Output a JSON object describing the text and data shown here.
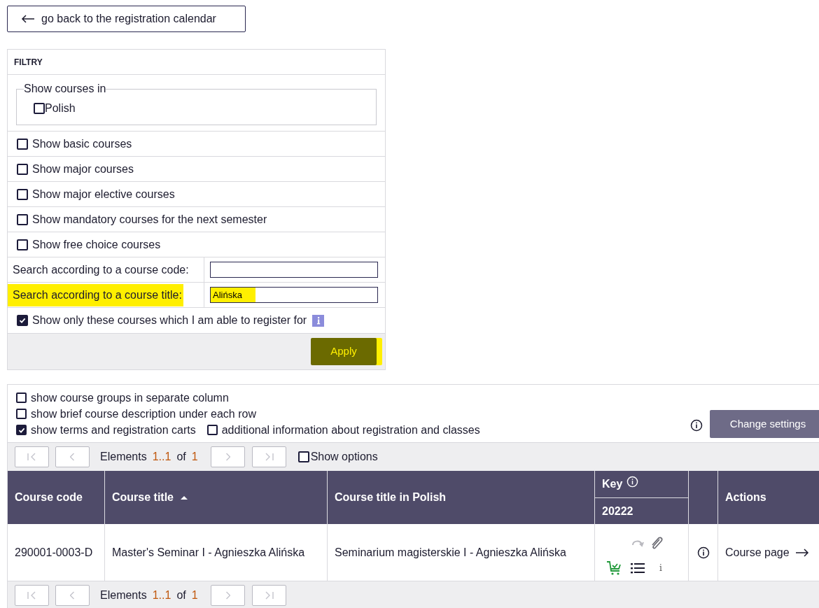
{
  "back_button": {
    "label": "go back to the registration calendar"
  },
  "filters": {
    "title": "FILTRY",
    "language_group": {
      "legend": "Show courses in",
      "options": [
        {
          "label": "Polish",
          "checked": false
        }
      ]
    },
    "checkboxes": [
      {
        "label": "Show basic courses",
        "checked": false
      },
      {
        "label": "Show major courses",
        "checked": false
      },
      {
        "label": "Show major elective courses",
        "checked": false
      },
      {
        "label": "Show mandatory courses for the next semester",
        "checked": false
      },
      {
        "label": "Show free choice courses",
        "checked": false
      }
    ],
    "search_fields": [
      {
        "label": "Search according to a course code:",
        "highlighted": false
      },
      {
        "label": "Search according to a course title:",
        "value": "Alińska",
        "highlighted": true
      }
    ],
    "register_only": {
      "label": "Show only these courses which I am able to register for",
      "checked": true
    },
    "apply_button": {
      "label": "Apply",
      "highlighted": true
    }
  },
  "settings": {
    "options": [
      {
        "label": "show course groups in separate column",
        "checked": false
      },
      {
        "label": "show brief course description under each row",
        "checked": false
      },
      {
        "label": "show terms and registration carts",
        "checked": true
      },
      {
        "label": "additional information about registration and classes",
        "checked": false
      }
    ],
    "change_button": "Change settings"
  },
  "pager_top": {
    "label": "Elements",
    "range": "1..1",
    "of": "of",
    "total": "1",
    "show_options": {
      "label": "Show options",
      "checked": false
    }
  },
  "table": {
    "columns": [
      "Course code",
      "Course title",
      "Course title in Polish",
      "Key",
      "Actions"
    ],
    "term": "20222",
    "rows": [
      {
        "code": "290001-0003-D",
        "title": "Master's Seminar I - Agnieszka Alińska",
        "title_pl": "Seminarium magisterskie I - Agnieszka Alińska",
        "info": "i",
        "link": "Course page"
      }
    ]
  },
  "pager_bottom": {
    "label": "Elements",
    "range": "1..1",
    "of": "of",
    "total": "1"
  }
}
